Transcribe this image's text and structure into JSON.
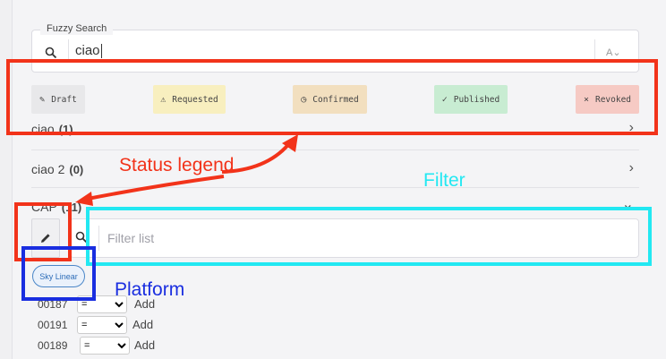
{
  "search": {
    "legend": "Fuzzy Search",
    "value": "ciao",
    "case_toggle": "A⌄"
  },
  "status_legend": [
    {
      "icon": "✎",
      "label": "Draft",
      "bg": "#e8e8ea"
    },
    {
      "icon": "⚠",
      "label": "Requested",
      "bg": "#f8efbf"
    },
    {
      "icon": "◷",
      "label": "Confirmed",
      "bg": "#f2dfbf"
    },
    {
      "icon": "✓",
      "label": "Published",
      "bg": "#c8ecd2"
    },
    {
      "icon": "×",
      "label": "Revoked",
      "bg": "#f6cac4"
    }
  ],
  "groups": [
    {
      "label": "ciao",
      "count": "(1)",
      "chevron": "›"
    },
    {
      "label": "ciao 2",
      "count": "(0)",
      "chevron": "›"
    },
    {
      "label": "CAP",
      "count": "(11)",
      "chevron": "⌄"
    }
  ],
  "filter": {
    "placeholder": "Filter list"
  },
  "platform": {
    "label": "Sky Linear"
  },
  "items": [
    {
      "code": "00187",
      "operator": "=",
      "action": "Add"
    },
    {
      "code": "00191",
      "operator": "=",
      "action": "Add"
    },
    {
      "code": "00189",
      "operator": "=",
      "action": "Add"
    }
  ],
  "annotations": {
    "status_legend": "Status legend",
    "filter": "Filter",
    "platform": "Platform",
    "colors": {
      "red": "#f2331a",
      "cyan": "#22e8f2",
      "blue": "#1a2ee0"
    }
  }
}
